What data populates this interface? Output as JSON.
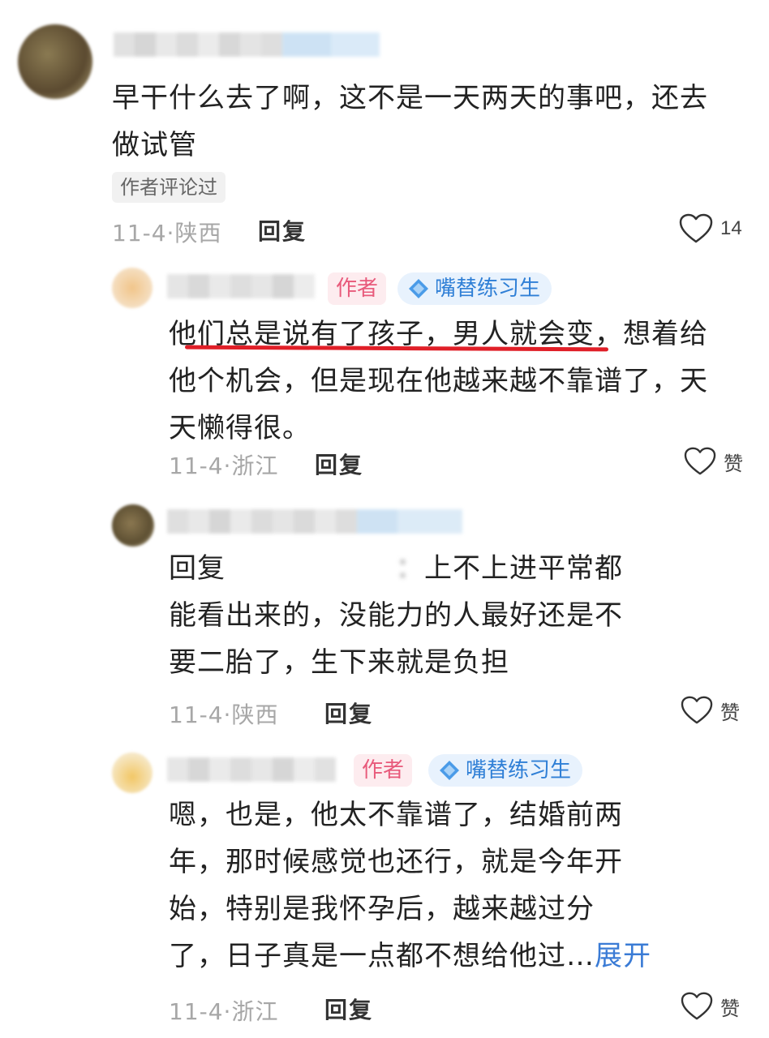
{
  "comments": [
    {
      "content_lines": [
        "早干什么去了啊，这不是一天两天的事吧，还去",
        "做试管"
      ],
      "badge": "作者评论过",
      "date_location": "11-4·陕西",
      "reply_label": "回复",
      "likes": "14"
    },
    {
      "author_tag": "作者",
      "level_tag": "嘴替练习生",
      "content_lines": [
        "他们总是说有了孩子，男人就会变，想着给",
        "他个机会，但是现在他越来越不靠谱了，天",
        "天懒得很。"
      ],
      "date_location": "11-4·浙江",
      "reply_label": "回复",
      "likes": "赞"
    },
    {
      "reply_prefix": "回复",
      "content_line1_rest": "上不上进平常都",
      "content_lines": [
        "能看出来的，没能力的人最好还是不",
        "要二胎了，生下来就是负担"
      ],
      "date_location": "11-4·陕西",
      "reply_label": "回复",
      "likes": "赞"
    },
    {
      "author_tag": "作者",
      "level_tag": "嘴替练习生",
      "content_lines": [
        "嗯，也是，他太不靠谱了，结婚前两",
        "年，那时候感觉也还行，就是今年开",
        "始，特别是我怀孕后，越来越过分",
        "了，日子真是一点都不想给他过…"
      ],
      "expand_label": "展开",
      "date_location": "11-4·浙江",
      "reply_label": "回复",
      "likes": "赞"
    }
  ],
  "colors": {
    "highlight_underline": "#e01f28",
    "author_tag": "#e85a7b",
    "level_tag": "#2f7fd6",
    "expand_link": "#3a7bd5"
  }
}
